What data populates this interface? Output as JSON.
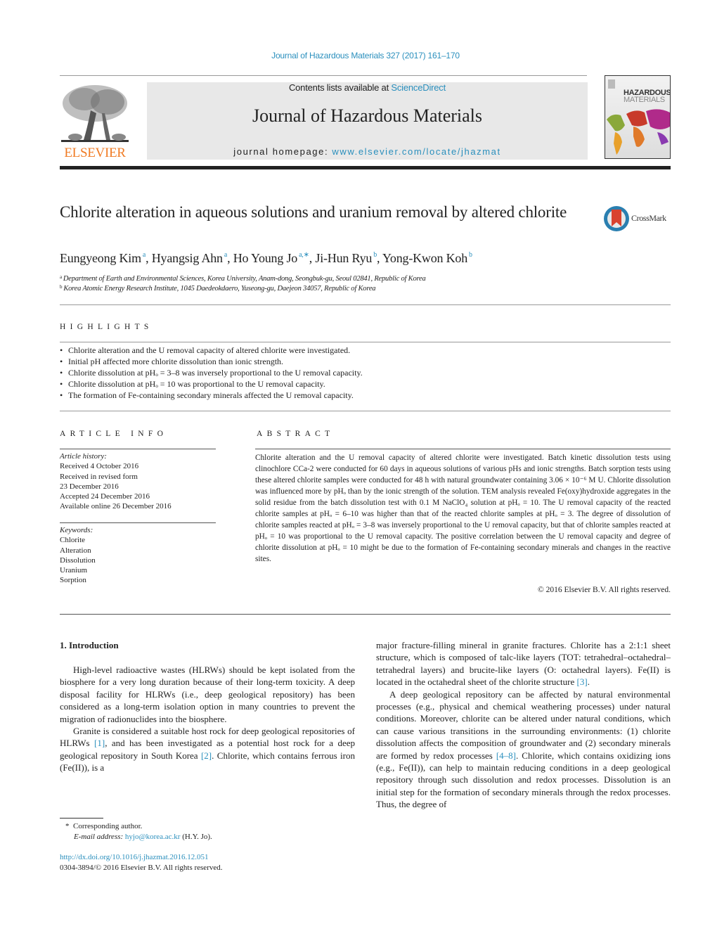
{
  "header": {
    "citation": "Journal of Hazardous Materials 327 (2017) 161–170",
    "contents_prefix": "Contents lists available at ",
    "contents_link": "ScienceDirect",
    "journal_name": "Journal of Hazardous Materials",
    "homepage_prefix": "journal homepage: ",
    "homepage_link": "www.elsevier.com/locate/jhazmat",
    "publisher_logo": "ELSEVIER",
    "cover_line1": "HAZARDOUS",
    "cover_line2": "MATERIALS",
    "colors": {
      "link": "#2a8fbd",
      "elsevier_orange": "#f07b24",
      "masthead_bg": "#e8e8e8"
    }
  },
  "article": {
    "title": "Chlorite alteration in aqueous solutions and uranium removal by altered chlorite",
    "crossmark_label": "CrossMark",
    "authors": [
      {
        "name": "Eungyeong Kim",
        "sup": "a"
      },
      {
        "name": "Hyangsig Ahn",
        "sup": "a"
      },
      {
        "name": "Ho Young Jo",
        "sup": "a,∗"
      },
      {
        "name": "Ji-Hun Ryu",
        "sup": "b"
      },
      {
        "name": "Yong-Kwon Koh",
        "sup": "b"
      }
    ],
    "affiliations": [
      {
        "mark": "a",
        "text": "Department of Earth and Environmental Sciences, Korea University, Anam-dong, Seongbuk-gu, Seoul 02841, Republic of Korea"
      },
      {
        "mark": "b",
        "text": "Korea Atomic Energy Research Institute, 1045 Daedeokdaero, Yuseong-gu, Daejeon 34057, Republic of Korea"
      }
    ]
  },
  "highlights": {
    "heading": "HIGHLIGHTS",
    "items": [
      "Chlorite alteration and the U removal capacity of altered chlorite were investigated.",
      "Initial pH affected more chlorite dissolution than ionic strength.",
      "Chlorite dissolution at pHₒ = 3–8 was inversely proportional to the U removal capacity.",
      "Chlorite dissolution at pHₒ = 10 was proportional to the U removal capacity.",
      "The formation of Fe-containing secondary minerals affected the U removal capacity."
    ]
  },
  "article_info": {
    "heading": "ARTICLE INFO",
    "history_label": "Article history:",
    "history": [
      "Received 4 October 2016",
      "Received in revised form",
      "23 December 2016",
      "Accepted 24 December 2016",
      "Available online 26 December 2016"
    ],
    "keywords_label": "Keywords:",
    "keywords": [
      "Chlorite",
      "Alteration",
      "Dissolution",
      "Uranium",
      "Sorption"
    ]
  },
  "abstract": {
    "heading": "ABSTRACT",
    "text": "Chlorite alteration and the U removal capacity of altered chlorite were investigated. Batch kinetic dissolution tests using clinochlore CCa-2 were conducted for 60 days in aqueous solutions of various pHs and ionic strengths. Batch sorption tests using these altered chlorite samples were conducted for 48 h with natural groundwater containing 3.06 × 10⁻⁶ M U. Chlorite dissolution was influenced more by pHₒ than by the ionic strength of the solution. TEM analysis revealed Fe(oxy)hydroxide aggregates in the solid residue from the batch dissolution test with 0.1 M NaClO₄ solution at pHₒ = 10. The U removal capacity of the reacted chlorite samples at pHₒ = 6–10 was higher than that of the reacted chlorite samples at pHₒ = 3. The degree of dissolution of chlorite samples reacted at pHₒ = 3–8 was inversely proportional to the U removal capacity, but that of chlorite samples reacted at pHₒ = 10 was proportional to the U removal capacity. The positive correlation between the U removal capacity and degree of chlorite dissolution at pHₒ = 10 might be due to the formation of Fe-containing secondary minerals and changes in the reactive sites.",
    "copyright": "© 2016 Elsevier B.V. All rights reserved."
  },
  "body": {
    "section_heading": "1.  Introduction",
    "left": {
      "p1": "High-level radioactive wastes (HLRWs) should be kept isolated from the biosphere for a very long duration because of their long-term toxicity. A deep disposal facility for HLRWs (i.e., deep geological repository) has been considered as a long-term isolation option in many countries to prevent the migration of radionuclides into the biosphere.",
      "p2_a": "Granite is considered a suitable host rock for deep geological repositories of HLRWs ",
      "p2_ref1": "[1]",
      "p2_b": ", and has been investigated as a potential host rock for a deep geological repository in South Korea ",
      "p2_ref2": "[2]",
      "p2_c": ". Chlorite, which contains ferrous iron (Fe(II)), is a"
    },
    "right": {
      "p1_a": "major fracture-filling mineral in granite fractures. Chlorite has a 2:1:1 sheet structure, which is composed of talc-like layers (TOT: tetrahedral–octahedral–tetrahedral layers) and brucite-like layers (O: octahedral layers). Fe(II) is located in the octahedral sheet of the chlorite structure ",
      "p1_ref": "[3]",
      "p1_b": ".",
      "p2_a": "A deep geological repository can be affected by natural environmental processes (e.g., physical and chemical weathering processes) under natural conditions. Moreover, chlorite can be altered under natural conditions, which can cause various transitions in the surrounding environments: (1) chlorite dissolution affects the composition of groundwater and (2) secondary minerals are formed by redox processes ",
      "p2_ref": "[4–8]",
      "p2_b": ". Chlorite, which contains oxidizing ions (e.g., Fe(II)), can help to maintain reducing conditions in a deep geological repository through such dissolution and redox processes. Dissolution is an initial step for the formation of secondary minerals through the redox processes. Thus, the degree of"
    }
  },
  "footnote": {
    "mark": "*",
    "corresponding": "Corresponding author.",
    "email_label": "E-mail address: ",
    "email": "hyjo@korea.ac.kr",
    "email_suffix": " (H.Y. Jo).",
    "doi": "http://dx.doi.org/10.1016/j.jhazmat.2016.12.051",
    "issn": "0304-3894/© 2016 Elsevier B.V. All rights reserved."
  }
}
